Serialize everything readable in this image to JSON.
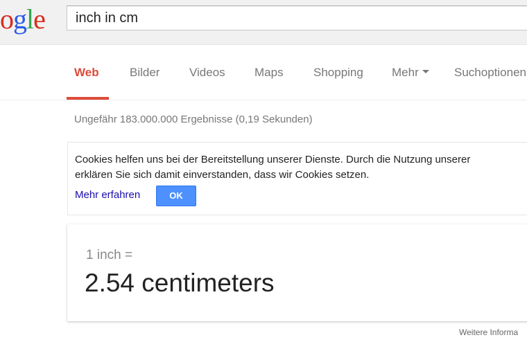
{
  "logo": {
    "letters": [
      "o",
      "g",
      "l",
      "e"
    ],
    "colors": [
      "#d62d20",
      "#2b5ce6",
      "#2fa84f",
      "#d62d20"
    ]
  },
  "search": {
    "value": "inch in cm"
  },
  "tabs": [
    {
      "label": "Web",
      "active": true
    },
    {
      "label": "Bilder"
    },
    {
      "label": "Videos"
    },
    {
      "label": "Maps"
    },
    {
      "label": "Shopping"
    },
    {
      "label": "Mehr"
    },
    {
      "label": "Suchoptionen"
    }
  ],
  "stats": "Ungefähr 183.000.000 Ergebnisse (0,19 Sekunden)",
  "cookie": {
    "line1": "Cookies helfen uns bei der Bereitstellung unserer Dienste. Durch die Nutzung unserer",
    "line2": "erklären Sie sich damit einverstanden, dass wir Cookies setzen.",
    "more_link": "Mehr erfahren",
    "ok_label": "OK"
  },
  "conversion": {
    "from": "1 inch =",
    "to": "2.54 centimeters"
  },
  "footer": {
    "more_info": "Weitere Informa"
  },
  "colors": {
    "accent": "#dd4b39",
    "button": "#4d90fe",
    "link": "#1a0dab"
  }
}
